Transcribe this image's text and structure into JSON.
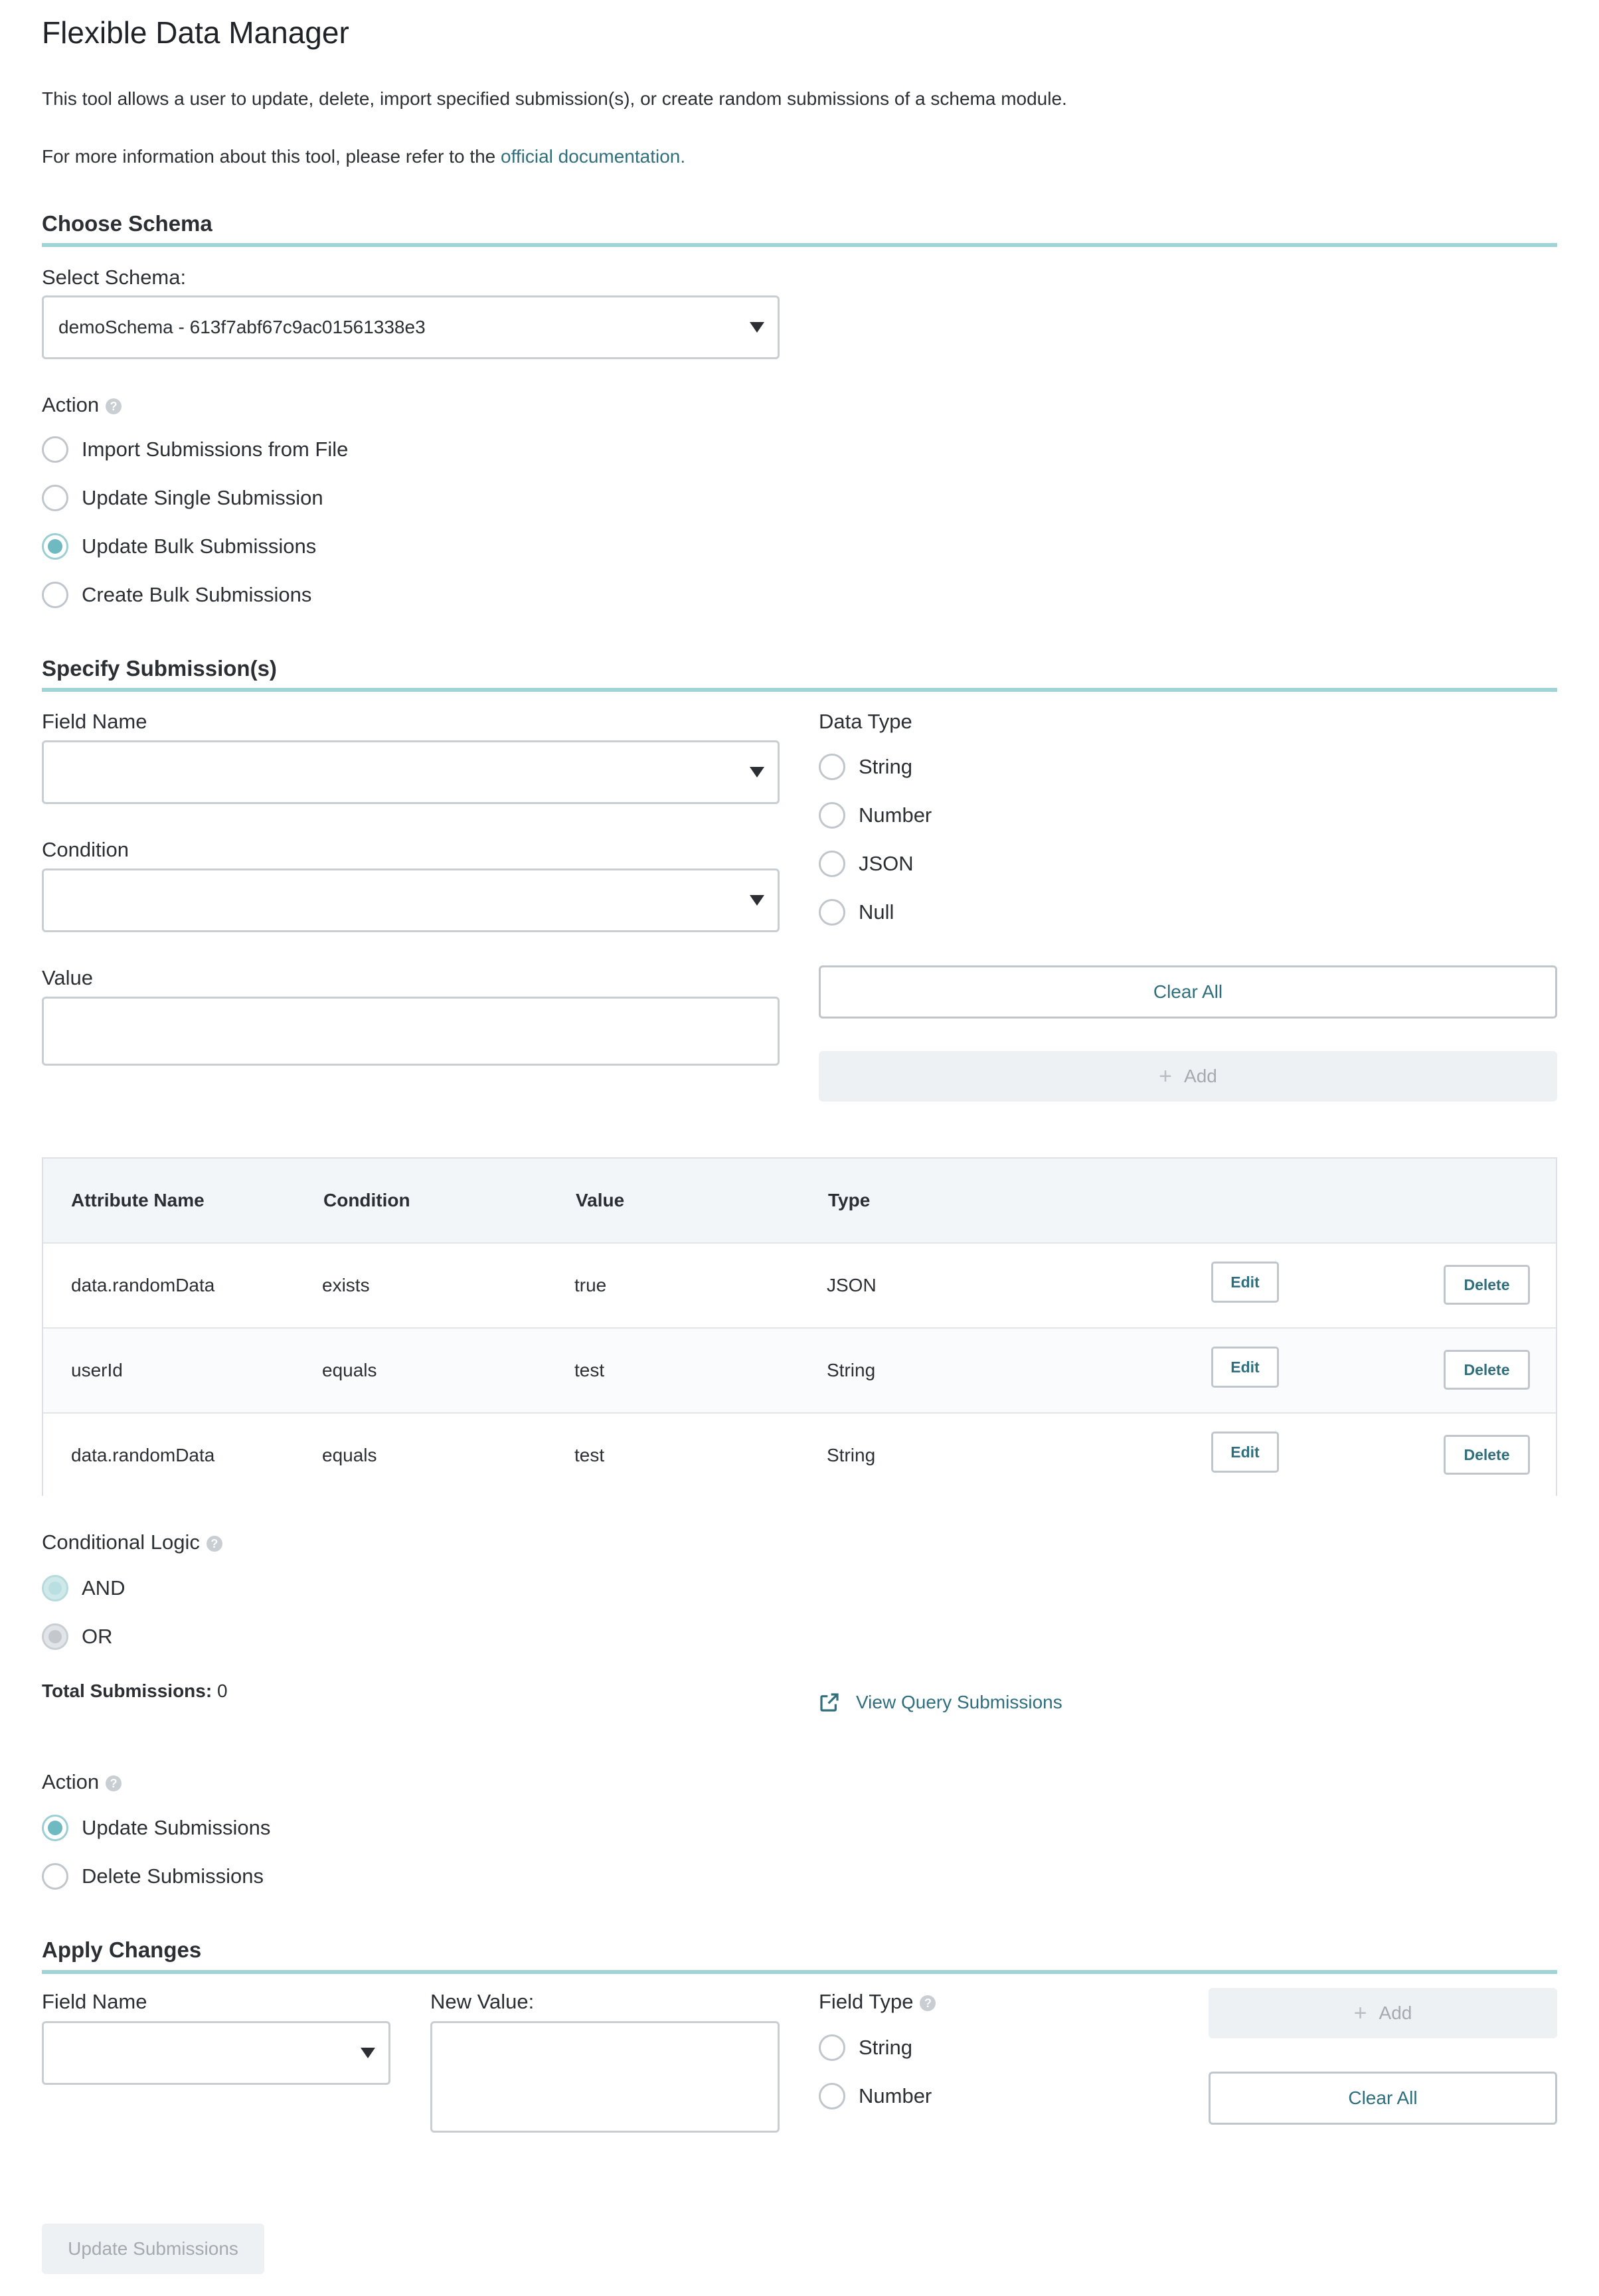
{
  "page": {
    "title": "Flexible Data Manager",
    "description": "This tool allows a user to update, delete, import specified submission(s), or create random submissions of a schema module.",
    "info_prefix": "For more information about this tool, please refer to the ",
    "info_link": "official documentation."
  },
  "choose_schema": {
    "section_title": "Choose Schema",
    "select_label": "Select Schema:",
    "selected_schema": "demoSchema - 613f7abf67c9ac01561338e3",
    "action_label": "Action",
    "actions": [
      {
        "label": "Import Submissions from File",
        "checked": false
      },
      {
        "label": "Update Single Submission",
        "checked": false
      },
      {
        "label": "Update Bulk Submissions",
        "checked": true
      },
      {
        "label": "Create Bulk Submissions",
        "checked": false
      }
    ]
  },
  "specify": {
    "section_title": "Specify Submission(s)",
    "field_name_label": "Field Name",
    "condition_label": "Condition",
    "value_label": "Value",
    "data_type_label": "Data Type",
    "data_types": [
      "String",
      "Number",
      "JSON",
      "Null"
    ],
    "clear_all_label": "Clear All",
    "add_label": "Add"
  },
  "table": {
    "headers": [
      "Attribute Name",
      "Condition",
      "Value",
      "Type"
    ],
    "rows": [
      {
        "attribute": "data.randomData",
        "condition": "exists",
        "value": "true",
        "type": "JSON"
      },
      {
        "attribute": "userId",
        "condition": "equals",
        "value": "test",
        "type": "String"
      },
      {
        "attribute": "data.randomData",
        "condition": "equals",
        "value": "test",
        "type": "String"
      }
    ],
    "edit_label": "Edit",
    "delete_label": "Delete"
  },
  "logic": {
    "label": "Conditional Logic",
    "options": [
      "AND",
      "OR"
    ],
    "total_label": "Total Submissions:",
    "total_value": "0",
    "view_query_label": "View Query Submissions"
  },
  "action2": {
    "label": "Action",
    "options": [
      {
        "label": "Update Submissions",
        "checked": true
      },
      {
        "label": "Delete Submissions",
        "checked": false
      }
    ]
  },
  "apply": {
    "section_title": "Apply Changes",
    "field_name_label": "Field Name",
    "new_value_label": "New Value:",
    "field_type_label": "Field Type",
    "field_types": [
      "String",
      "Number"
    ],
    "add_label": "Add",
    "clear_all_label": "Clear All",
    "submit_label": "Update Submissions"
  },
  "colors": {
    "accent": "#6fb9c0",
    "rule": "#9fd3d6",
    "link": "#2f6f7d"
  }
}
